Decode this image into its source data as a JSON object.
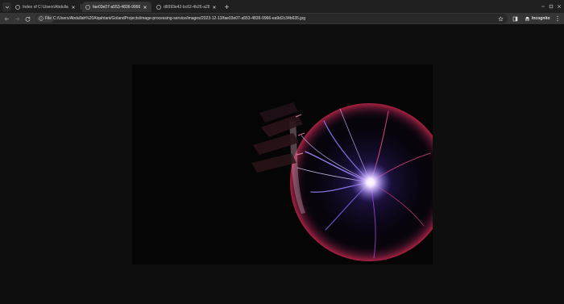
{
  "tabs": [
    {
      "title": "Index of C:\\Users\\Abdullah Al...",
      "active": false
    },
    {
      "title": "fae03e07-a553-4836-9966-e...",
      "active": true
    },
    {
      "title": "d6093e42-bc62-4b26-a284-07...",
      "active": false
    }
  ],
  "address_bar": {
    "scheme_chip": "File",
    "url": "C:/Users/Abdullah%20Alqahtani/GolandProjects/image-processing-service/images/2023-12-13/fae03e07-a553-4836-9966-ea9d2c34b635.jpg"
  },
  "profile": {
    "label": "Incognito"
  },
  "image": {
    "subject": "plasma globe with a hand touching the glass"
  },
  "icons": {
    "tab_search": "chevron-down-icon",
    "favicon": "globe-icon",
    "close": "close-icon",
    "new_tab": "plus-icon",
    "back": "arrow-left-icon",
    "forward": "arrow-right-icon",
    "reload": "reload-icon",
    "info": "info-icon",
    "bookmark": "star-icon",
    "side_panel": "side-panel-icon",
    "incognito": "incognito-icon",
    "menu": "kebab-icon",
    "minimize": "minimize-icon",
    "maximize": "maximize-icon",
    "window_close": "window-close-icon"
  },
  "colors": {
    "tabstrip": "#1f1f1f",
    "toolbar": "#353535",
    "omnibox": "#282828",
    "page_background": "#0e0e0e"
  }
}
